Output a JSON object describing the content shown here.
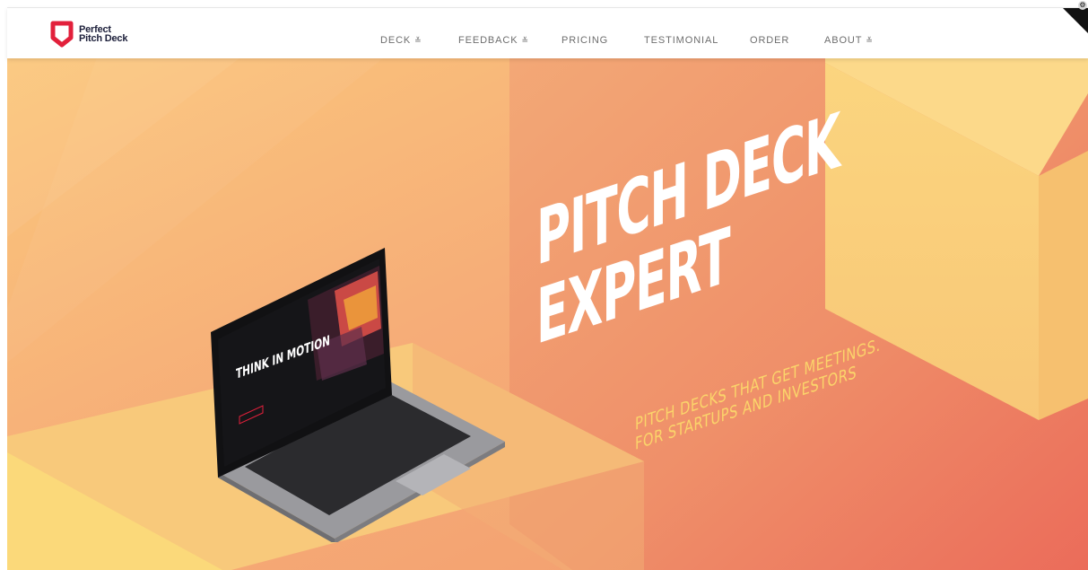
{
  "brand": {
    "line1": "Perfect",
    "line2": "Pitch Deck",
    "color": "#e2203b"
  },
  "nav": [
    {
      "label": "DECK",
      "has_dropdown": true,
      "icon": "double-chevron-down-icon"
    },
    {
      "label": "FEEDBACK",
      "has_dropdown": true,
      "icon": "double-chevron-down-icon"
    },
    {
      "label": "PRICING",
      "has_dropdown": false
    },
    {
      "label": "TESTIMONIAL",
      "has_dropdown": false
    },
    {
      "label": "ORDER",
      "has_dropdown": false
    },
    {
      "label": "ABOUT",
      "has_dropdown": true,
      "icon": "double-chevron-down-icon"
    }
  ],
  "chevron_glyph": "≚",
  "hero": {
    "headline_line1": "PITCH DECK",
    "headline_line2": "EXPERT",
    "sub_line1": "PITCH DECKS THAT GET MEETINGS.",
    "sub_line2": "FOR STARTUPS AND INVESTORS",
    "laptop_screen_title": "THINK IN MOTION",
    "colors": {
      "sand": "#fbd97a",
      "peach": "#f4a878",
      "coral": "#ee7a62",
      "text_yellow": "#fbd46a"
    }
  }
}
